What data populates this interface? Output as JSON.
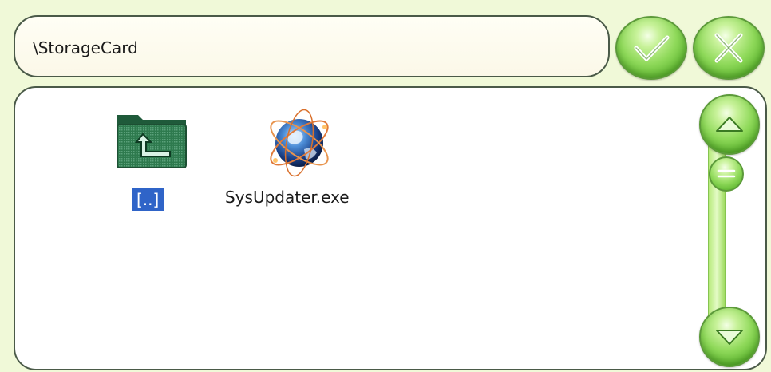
{
  "path_bar": {
    "path": "\\StorageCard"
  },
  "buttons": {
    "ok_icon": "checkmark-icon",
    "cancel_icon": "close-icon"
  },
  "files": [
    {
      "name": "[..]",
      "icon": "folder-up-icon",
      "selected": true
    },
    {
      "name": "SysUpdater.exe",
      "icon": "globe-app-icon",
      "selected": false
    }
  ],
  "scrollbar": {
    "up_icon": "triangle-up-icon",
    "down_icon": "triangle-down-icon",
    "thumb_icon": "grip-lines-icon"
  },
  "colors": {
    "background": "#f0f9d8",
    "accent_green": "#5cb52e",
    "selection": "#2f64c8"
  }
}
